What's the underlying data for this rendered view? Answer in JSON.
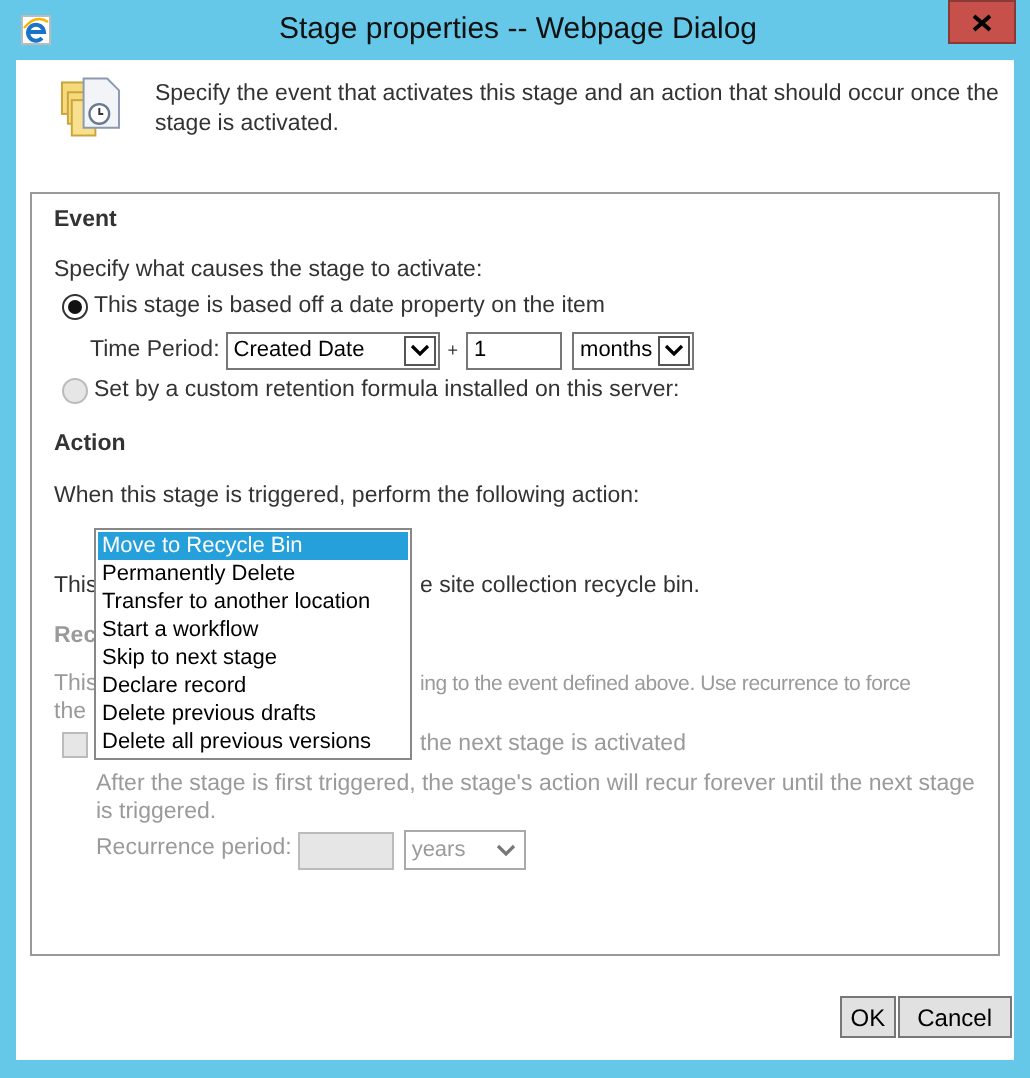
{
  "window": {
    "title": "Stage properties -- Webpage Dialog"
  },
  "header": {
    "text": "Specify the event that activates this stage and an action that should occur once the stage is activated."
  },
  "event": {
    "heading": "Event",
    "prompt": "Specify what causes the stage to activate:",
    "options": [
      {
        "kind": "date",
        "label": "This stage is based off a date property on the item",
        "selected": true
      },
      {
        "kind": "formula",
        "label": "Set by a custom retention formula installed on this server:",
        "selected": false
      }
    ],
    "time_period": {
      "label": "Time Period:",
      "field": "Created Date",
      "plus": "+",
      "amount": "1",
      "unit": "months"
    }
  },
  "action": {
    "heading": "Action",
    "prompt": "When this stage is triggered, perform the following action:",
    "list": [
      {
        "label": "Move to Recycle Bin",
        "selected": true
      },
      {
        "label": "Permanently Delete",
        "selected": false
      },
      {
        "label": "Transfer to another location",
        "selected": false
      },
      {
        "label": "Start a workflow",
        "selected": false
      },
      {
        "label": "Skip to next stage",
        "selected": false
      },
      {
        "label": "Declare record",
        "selected": false
      },
      {
        "label": "Delete previous drafts",
        "selected": false
      },
      {
        "label": "Delete all previous versions",
        "selected": false
      }
    ],
    "description": [
      "This",
      "e site collection recycle bin."
    ]
  },
  "recurrence": {
    "disabled": true,
    "heading": "Rec",
    "text": [
      "This",
      "ing to the event defined above. Use recurrence to force",
      "the"
    ],
    "checkbox": {
      "checked": false,
      "label": "the next stage is activated"
    },
    "note": "After the stage is first triggered, the stage's action will recur forever until the next stage is triggered.",
    "period_label": "Recurrence period:",
    "unit": "years"
  },
  "buttons": [
    "OK",
    "Cancel"
  ]
}
